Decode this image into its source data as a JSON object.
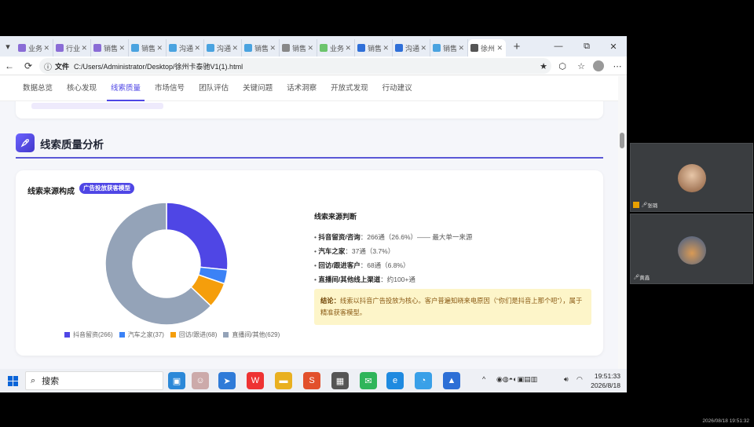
{
  "browser": {
    "tabs": [
      {
        "label": "业务",
        "color": "#8a6cd6"
      },
      {
        "label": "行业",
        "color": "#8a6cd6"
      },
      {
        "label": "销售",
        "color": "#8a6cd6"
      },
      {
        "label": "销售",
        "color": "#4aa3e0"
      },
      {
        "label": "沟通",
        "color": "#4aa3e0"
      },
      {
        "label": "沟通",
        "color": "#4aa3e0"
      },
      {
        "label": "销售",
        "color": "#4aa3e0"
      },
      {
        "label": "销售",
        "color": "#888888"
      },
      {
        "label": "业务",
        "color": "#6cc46c"
      },
      {
        "label": "销售",
        "color": "#2f6fd8"
      },
      {
        "label": "沟通",
        "color": "#2f6fd8"
      },
      {
        "label": "销售",
        "color": "#4aa3e0"
      },
      {
        "label": "徐州",
        "color": "#555555"
      }
    ],
    "active_tab_index": 12,
    "url_scheme": "文件",
    "url": "C:/Users/Administrator/Desktop/徐州卡泰驰V1(1).html"
  },
  "page_nav": {
    "items": [
      "数据总览",
      "核心发现",
      "线索质量",
      "市场信号",
      "团队评估",
      "关键问题",
      "话术洞察",
      "开放式发现",
      "行动建议"
    ],
    "active_index": 2
  },
  "section": {
    "title": "线索质量分析",
    "icon": "rocket-icon"
  },
  "card": {
    "title": "线索来源构成",
    "badge": "广告投放获客模型"
  },
  "chart_data": {
    "type": "pie",
    "donut": true,
    "categories": [
      "抖音留资",
      "汽车之家",
      "回访/跟进",
      "直播间/其他"
    ],
    "values": [
      266,
      37,
      68,
      629
    ],
    "colors": [
      "#4f46e5",
      "#3b82f6",
      "#f59e0b",
      "#94a3b8"
    ],
    "legend_labels": [
      "抖音留资(266)",
      "汽车之家(37)",
      "回访/跟进(68)",
      "直播间/其他(629)"
    ],
    "legend_position": "bottom"
  },
  "judgement": {
    "title": "线索来源判断",
    "items": [
      {
        "key": "抖音留资/咨询",
        "val": "：266通（26.6%）—— 最大单一来源"
      },
      {
        "key": "汽车之家",
        "val": "：37通（3.7%）"
      },
      {
        "key": "回访/跟进客户",
        "val": "：68通（6.8%）"
      },
      {
        "key": "直播间/其他线上渠道",
        "val": "：约100+通"
      }
    ],
    "conclusion_label": "结论：",
    "conclusion_text": "线索以抖音广告投放为核心。客户普遍知晓来电原因（“你们是抖音上那个吧”），属于精准获客模型。"
  },
  "taskbar": {
    "search_placeholder": "搜索",
    "time": "19:51:33",
    "date": "2026/8/18"
  },
  "video": {
    "panel1_name": "张璐",
    "panel2_name": "黄鑫",
    "timestamp": "2026/08/18 19:51:32"
  }
}
